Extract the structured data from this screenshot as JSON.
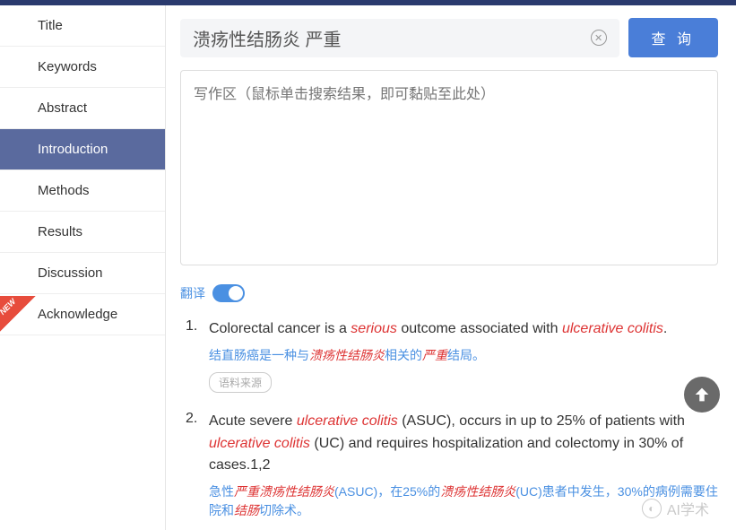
{
  "nav": {
    "items": [
      {
        "label": "Title"
      },
      {
        "label": "Keywords"
      },
      {
        "label": "Abstract"
      },
      {
        "label": "Introduction",
        "active": true
      },
      {
        "label": "Methods"
      },
      {
        "label": "Results"
      },
      {
        "label": "Discussion"
      },
      {
        "label": "Acknowledge",
        "new": true
      }
    ],
    "new_badge": "NEW"
  },
  "search": {
    "value": "溃疡性结肠炎 严重",
    "query_label": "查 询"
  },
  "writing_area": {
    "placeholder": "写作区（鼠标单击搜索结果，即可黏贴至此处）"
  },
  "translate": {
    "label": "翻译",
    "enabled": true
  },
  "results": [
    {
      "num": "1.",
      "en_parts": [
        "Colorectal cancer is a ",
        {
          "hl": "serious"
        },
        " outcome associated with ",
        {
          "hl": "ulcerative colitis"
        },
        "."
      ],
      "zh_parts": [
        "结直肠癌是一种与",
        {
          "hl": "溃疡性结肠炎"
        },
        "相关的",
        {
          "hl": "严重"
        },
        "结局。"
      ],
      "source_label": "语料来源"
    },
    {
      "num": "2.",
      "en_parts": [
        "Acute severe ",
        {
          "hl": "ulcerative colitis"
        },
        " (ASUC), occurs in up to 25% of patients with ",
        {
          "hl": "ulcerative colitis"
        },
        " (UC) and requires hospitalization and colectomy in 30% of cases.1,2"
      ],
      "zh_parts": [
        "急性",
        {
          "hl": "严重溃疡性结肠炎"
        },
        "(ASUC)，在25%的",
        {
          "hl": "溃疡性结肠炎"
        },
        "(UC)患者中发生，30%的病例需要住院和",
        {
          "hl": "结肠"
        },
        "切除术。"
      ]
    }
  ],
  "watermark": {
    "text": "AI学术"
  }
}
